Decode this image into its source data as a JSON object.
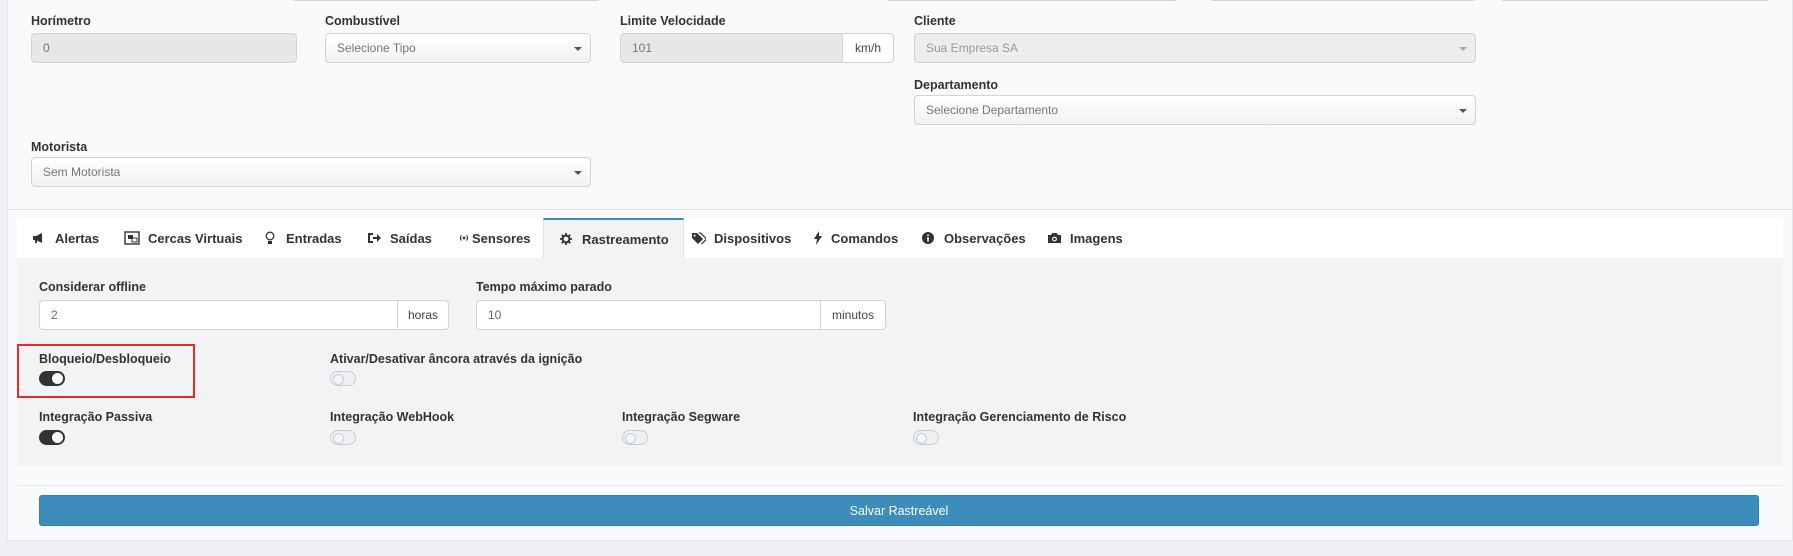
{
  "form": {
    "horimetro": {
      "label": "Horímetro",
      "value": "0"
    },
    "combustivel": {
      "label": "Combustível",
      "value": "Selecione Tipo"
    },
    "limite_velocidade": {
      "label": "Limite Velocidade",
      "value": "101",
      "unit": "km/h"
    },
    "cliente": {
      "label": "Cliente",
      "value": "Sua Empresa SA"
    },
    "departamento": {
      "label": "Departamento",
      "value": "Selecione Departamento"
    },
    "motorista": {
      "label": "Motorista",
      "value": "Sem Motorista"
    }
  },
  "tabs": [
    {
      "label": "Alertas",
      "icon": "bullhorn-icon"
    },
    {
      "label": "Cercas Virtuais",
      "icon": "object-group-icon"
    },
    {
      "label": "Entradas",
      "icon": "lightbulb-icon"
    },
    {
      "label": "Saídas",
      "icon": "sign-out-icon"
    },
    {
      "label": "Sensores",
      "icon": "signal-icon"
    },
    {
      "label": "Rastreamento",
      "icon": "gear-icon",
      "active": true
    },
    {
      "label": "Dispositivos",
      "icon": "tags-icon"
    },
    {
      "label": "Comandos",
      "icon": "bolt-icon"
    },
    {
      "label": "Observações",
      "icon": "info-circle-icon"
    },
    {
      "label": "Imagens",
      "icon": "camera-icon"
    }
  ],
  "rastreamento": {
    "considerar_offline": {
      "label": "Considerar offline",
      "value": "2",
      "unit": "horas"
    },
    "tempo_maximo_parado": {
      "label": "Tempo máximo parado",
      "value": "10",
      "unit": "minutos"
    },
    "toggles": [
      {
        "label": "Bloqueio/Desbloqueio",
        "on": true
      },
      {
        "label": "Ativar/Desativar âncora através da ignição",
        "on": false
      },
      {
        "label": "Integração Passiva",
        "on": true
      },
      {
        "label": "Integração WebHook",
        "on": false
      },
      {
        "label": "Integração Segware",
        "on": false
      },
      {
        "label": "Integração Gerenciamento de Risco",
        "on": false
      }
    ]
  },
  "save_button": "Salvar Rastreável",
  "colors": {
    "primary": "#3c8dbc",
    "highlight": "#e32b2b",
    "toggle_on": "#333333"
  }
}
